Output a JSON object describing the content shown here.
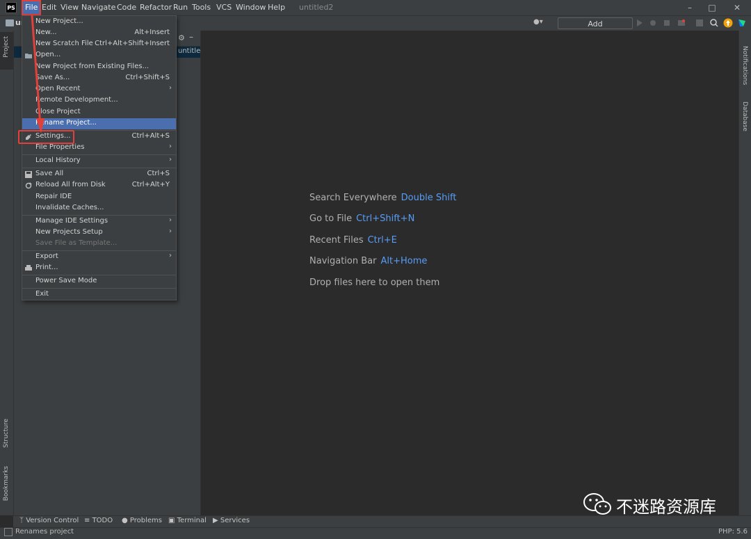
{
  "menubar": {
    "logo": "PS",
    "items": [
      "File",
      "Edit",
      "View",
      "Navigate",
      "Code",
      "Refactor",
      "Run",
      "Tools",
      "VCS",
      "Window",
      "Help"
    ],
    "project_title": "untitled2"
  },
  "toolbar": {
    "nav_label": "ur",
    "add_configuration": "Add Configuration..."
  },
  "left_tools": {
    "project": "Project",
    "structure": "Structure",
    "bookmarks": "Bookmarks"
  },
  "right_tools": {
    "notifications": "Notifications",
    "database": "Database"
  },
  "project_panel": {
    "row_label": "untitled"
  },
  "editor_hints": [
    {
      "label": "Search Everywhere",
      "key": "Double Shift"
    },
    {
      "label": "Go to File",
      "key": "Ctrl+Shift+N"
    },
    {
      "label": "Recent Files",
      "key": "Ctrl+E"
    },
    {
      "label": "Navigation Bar",
      "key": "Alt+Home"
    },
    {
      "label": "Drop files here to open them",
      "key": ""
    }
  ],
  "file_menu": [
    {
      "label": "New Project...",
      "shortcut": ""
    },
    {
      "label": "New...",
      "shortcut": "Alt+Insert"
    },
    {
      "label": "New Scratch File",
      "shortcut": "Ctrl+Alt+Shift+Insert"
    },
    {
      "label": "Open...",
      "shortcut": ""
    },
    {
      "label": "New Project from Existing Files...",
      "shortcut": ""
    },
    {
      "label": "Save As...",
      "shortcut": "Ctrl+Shift+S"
    },
    {
      "label": "Open Recent",
      "shortcut": ""
    },
    {
      "label": "Remote Development...",
      "shortcut": ""
    },
    {
      "label": "Close Project",
      "shortcut": ""
    },
    {
      "label": "Rename Project...",
      "shortcut": ""
    },
    {
      "label": "Settings...",
      "shortcut": "Ctrl+Alt+S"
    },
    {
      "label": "File Properties",
      "shortcut": ""
    },
    {
      "label": "Local History",
      "shortcut": ""
    },
    {
      "label": "Save All",
      "shortcut": "Ctrl+S"
    },
    {
      "label": "Reload All from Disk",
      "shortcut": "Ctrl+Alt+Y"
    },
    {
      "label": "Repair IDE",
      "shortcut": ""
    },
    {
      "label": "Invalidate Caches...",
      "shortcut": ""
    },
    {
      "label": "Manage IDE Settings",
      "shortcut": ""
    },
    {
      "label": "New Projects Setup",
      "shortcut": ""
    },
    {
      "label": "Save File as Template...",
      "shortcut": ""
    },
    {
      "label": "Export",
      "shortcut": ""
    },
    {
      "label": "Print...",
      "shortcut": ""
    },
    {
      "label": "Power Save Mode",
      "shortcut": ""
    },
    {
      "label": "Exit",
      "shortcut": ""
    }
  ],
  "bottom_tabs": [
    "Version Control",
    "TODO",
    "Problems",
    "Terminal",
    "Services"
  ],
  "status": {
    "message": "Renames project",
    "php": "PHP: 5.6"
  },
  "watermark": "不迷路资源库",
  "colors": {
    "accent": "#4b6eaf",
    "annotation_red": "#e0413b",
    "link_blue": "#589df6"
  }
}
